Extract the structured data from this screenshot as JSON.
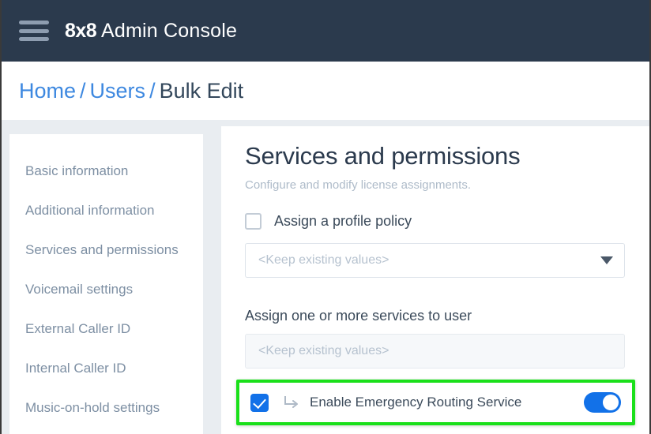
{
  "header": {
    "menu_icon": "hamburger-icon",
    "brand_mark": "8x8",
    "brand_name": " Admin Console"
  },
  "breadcrumb": {
    "items": [
      {
        "label": "Home",
        "current": false
      },
      {
        "label": "Users",
        "current": false
      },
      {
        "label": "Bulk Edit",
        "current": true
      }
    ],
    "separator": "/"
  },
  "sidebar": {
    "items": [
      {
        "label": "Basic information"
      },
      {
        "label": "Additional information"
      },
      {
        "label": "Services and permissions"
      },
      {
        "label": "Voicemail settings"
      },
      {
        "label": "External Caller ID"
      },
      {
        "label": "Internal Caller ID"
      },
      {
        "label": "Music-on-hold settings"
      }
    ]
  },
  "main": {
    "title": "Services and permissions",
    "subtitle": "Configure and modify license assignments.",
    "profile_policy": {
      "checkbox_label": "Assign a profile policy",
      "checked": false,
      "select_value": "<Keep existing values>",
      "chevron_icon": "chevron-down-icon"
    },
    "services": {
      "label": "Assign one or more services to user",
      "select_value": "<Keep existing values>"
    },
    "emergency_routing": {
      "checked": true,
      "sub_arrow_icon": "corner-down-right-arrow-icon",
      "label": "Enable Emergency Routing Service",
      "toggle_on": true
    }
  },
  "colors": {
    "header_bg": "#2b3a4d",
    "link_blue": "#3d88e0",
    "accent_blue": "#1271e8",
    "highlight_green": "#1ae01a",
    "panel_gray": "#e9edf1",
    "muted_text": "#7d8fa3",
    "placeholder_text": "#b6c2cf"
  }
}
